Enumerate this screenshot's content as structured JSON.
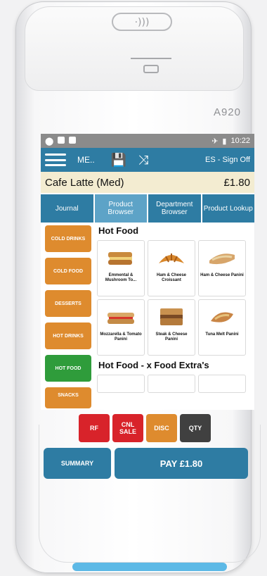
{
  "device": {
    "nfc_symbol": "·)))",
    "brand": "A920"
  },
  "statusbar": {
    "time": "10:22"
  },
  "appbar": {
    "menu_label": "ME..",
    "sign_off": "ES - Sign Off"
  },
  "order": {
    "item": "Cafe Latte (Med)",
    "price": "£1.80"
  },
  "tabs": [
    {
      "label": "Journal"
    },
    {
      "label": "Product Browser"
    },
    {
      "label": "Department Browser"
    },
    {
      "label": "Product Lookup"
    }
  ],
  "categories": [
    {
      "label": "COLD DRINKS"
    },
    {
      "label": "COLD FOOD"
    },
    {
      "label": "DESSERTS"
    },
    {
      "label": "HOT DRINKS"
    },
    {
      "label": "HOT FOOD"
    },
    {
      "label": "SNACKS"
    }
  ],
  "section": {
    "title": "Hot Food",
    "extras_title": "Hot Food - x Food Extra's"
  },
  "products": [
    {
      "name": "Emmental & Mushroom To..."
    },
    {
      "name": "Ham & Cheese Croissant"
    },
    {
      "name": "Ham & Cheese Panini"
    },
    {
      "name": "Mozzarella & Tomato Panini"
    },
    {
      "name": "Steak & Cheese Panini"
    },
    {
      "name": "Tuna Melt Panini"
    }
  ],
  "actions": {
    "rf": "RF",
    "cnl_sale": "CNL SALE",
    "disc": "DISC",
    "qty": "QTY",
    "summary": "SUMMARY",
    "pay": "PAY £1.80"
  },
  "colors": {
    "primary": "#2e7ca3",
    "category": "#de8b2e",
    "category_active": "#2f9c3b",
    "rf": "#d8232a",
    "disc": "#de8b2e",
    "qty": "#404040",
    "status": "#8b8b8b"
  }
}
